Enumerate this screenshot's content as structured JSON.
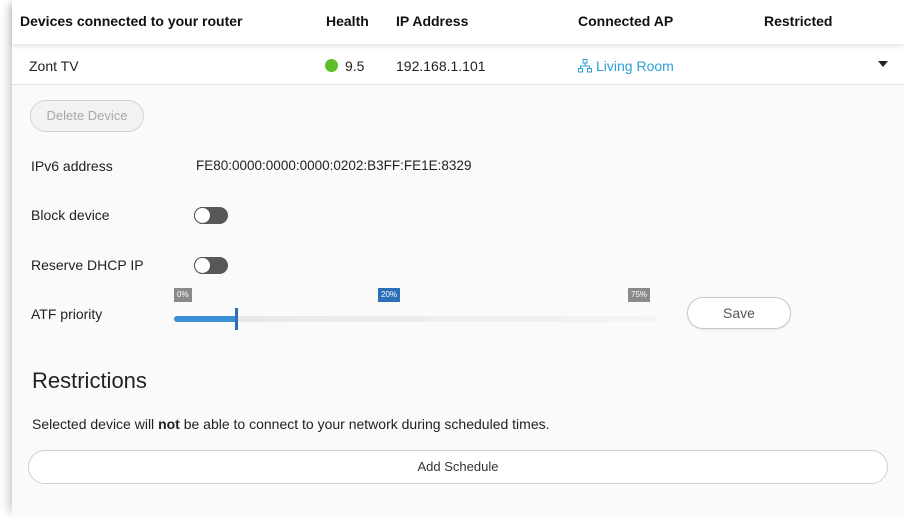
{
  "header": {
    "devices_label": "Devices connected to your router",
    "health_label": "Health",
    "ip_label": "IP Address",
    "ap_label": "Connected AP",
    "restricted_label": "Restricted"
  },
  "device": {
    "name": "Zont TV",
    "health": "9.5",
    "health_color": "#5cbf2a",
    "ip": "192.168.1.101",
    "ap": "Living Room",
    "ap_icon": "network-icon",
    "expand_icon": "caret-down-icon"
  },
  "details": {
    "delete_label": "Delete Device",
    "ipv6_label": "IPv6 address",
    "ipv6_value": "FE80:0000:0000:0000:0202:B3FF:FE1E:8329",
    "block_label": "Block device",
    "block_on": false,
    "reserve_label": "Reserve DHCP IP",
    "reserve_on": false,
    "atf_label": "ATF priority",
    "atf_ticks": [
      "0%",
      "20%",
      "75%"
    ],
    "atf_value_percent": 20,
    "save_label": "Save"
  },
  "restrictions": {
    "title": "Restrictions",
    "note_prefix": "Selected device will ",
    "note_bold": "not",
    "note_suffix": " be able to connect to your network during scheduled times.",
    "add_schedule_label": "Add Schedule"
  },
  "colors": {
    "accent": "#2f9fd8",
    "slider": "#3b8fd6",
    "slider_active_tick": "#2c6fb8"
  }
}
